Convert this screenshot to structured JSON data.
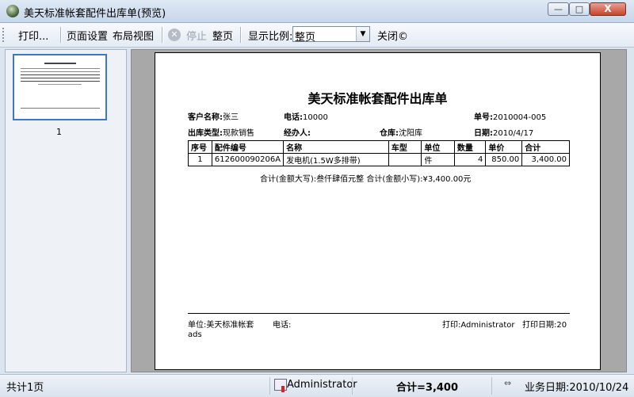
{
  "window": {
    "title": "美天标准帐套配件出库单(预览)",
    "min_symbol": "—",
    "max_symbol": "□",
    "close_symbol": "X"
  },
  "toolbar": {
    "print": "打印...",
    "page_setup": "页面设置",
    "layout_view": "布局视图",
    "stop_icon": "✕",
    "stop": "停止",
    "whole_page": "整页",
    "zoom_label": "显示比例:",
    "zoom_value": "整页",
    "close": "关闭©"
  },
  "thumbnails": {
    "page_number": "1"
  },
  "document": {
    "title": "美天标准帐套配件出库单",
    "customer_label": "客户名称:",
    "customer_value": "张三",
    "phone_label": "电话:",
    "phone_value": "10000",
    "order_no_label": "单号:",
    "order_no_value": "2010004-005",
    "out_type_label": "出库类型:",
    "out_type_value": "现款销售",
    "handler_label": "经办人:",
    "handler_value": "",
    "warehouse_label": "仓库:",
    "warehouse_value": "沈阳库",
    "date_label": "日期:",
    "date_value": "2010/4/17",
    "table": {
      "headers": [
        "序号",
        "配件编号",
        "名称",
        "车型",
        "单位",
        "数量",
        "单价",
        "合计"
      ],
      "rows": [
        [
          "1",
          "612600090206A",
          "发电机(1.5W多排带)",
          "",
          "件",
          "4",
          "850.00",
          "3,400.00"
        ]
      ]
    },
    "total_line": "合计(金额大写):叁仟肆佰元整  合计(金额小写):¥3,400.00元",
    "footer_unit": "单位:美天标准帐套",
    "footer_phone": "电话:",
    "footer_print": "打印:Administrator",
    "footer_print_date": "打印日期:20",
    "footer_extra": "ads"
  },
  "status": {
    "page_count": "共计1页",
    "user": "Administrator",
    "total": "合计=3,400",
    "business_date": "业务日期:2010/10/24"
  }
}
